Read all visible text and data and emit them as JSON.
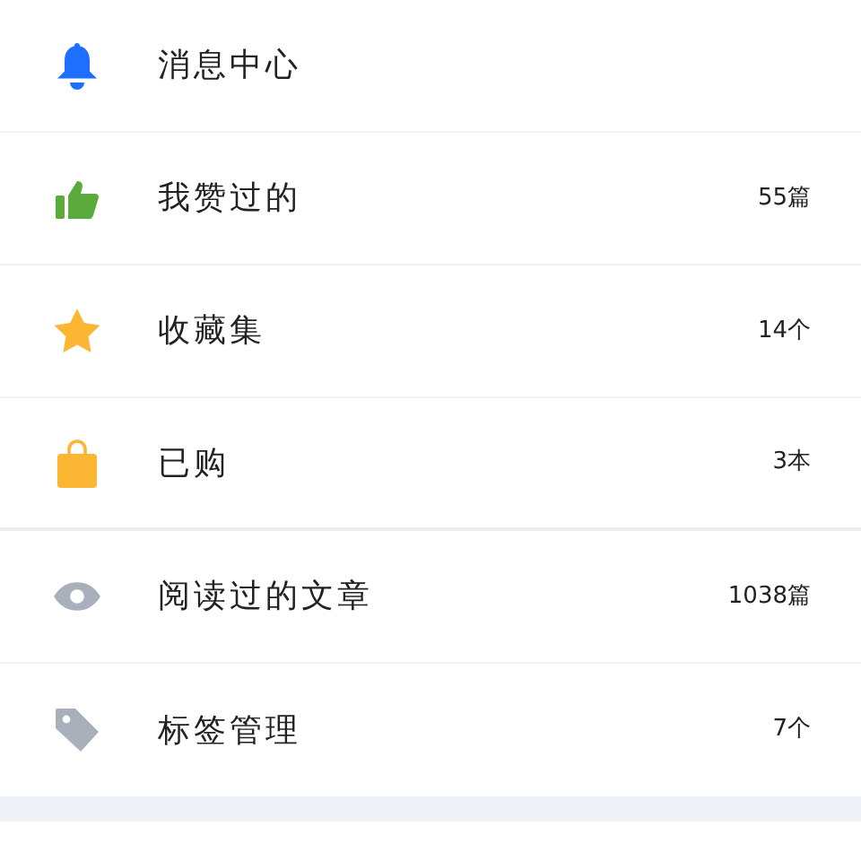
{
  "menu": [
    {
      "kind": "bell",
      "label": "消息中心"
    },
    {
      "kind": "thumb",
      "label": "我赞过的",
      "count": "55篇"
    },
    {
      "kind": "star",
      "label": "收藏集",
      "count": "14个"
    },
    {
      "kind": "bag",
      "label": "已购",
      "count": "3本"
    },
    {
      "kind": "eye",
      "label": "阅读过的文章",
      "count": "1038篇"
    },
    {
      "kind": "tag",
      "label": "标签管理",
      "count": "7个"
    }
  ]
}
